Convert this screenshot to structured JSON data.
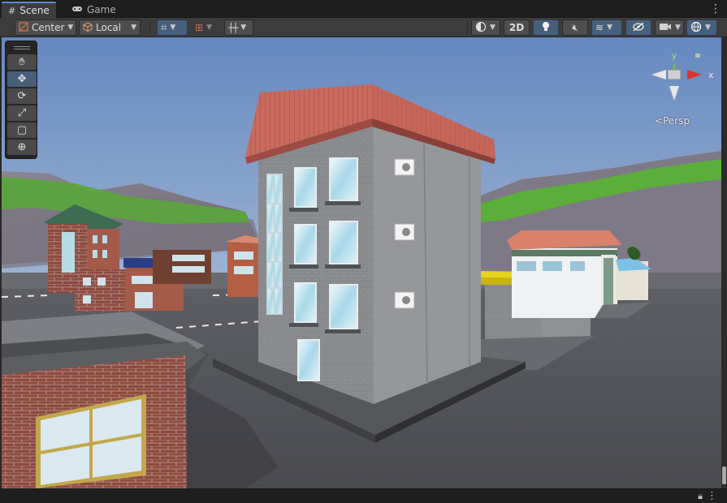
{
  "tabs": [
    {
      "label": "Scene",
      "icon": "grid-icon",
      "active": true
    },
    {
      "label": "Game",
      "icon": "gamepad-icon",
      "active": false
    }
  ],
  "toolbar": {
    "pivot_mode": "Center",
    "pivot_rotation": "Local",
    "mode_2d": "2D"
  },
  "gizmo": {
    "axis_y": "y",
    "axis_x": "x",
    "projection": "Persp"
  },
  "tools": [
    {
      "name": "hand-tool",
      "icon": "hand-icon"
    },
    {
      "name": "move-tool",
      "icon": "move-icon"
    },
    {
      "name": "rotate-tool",
      "icon": "rotate-icon"
    },
    {
      "name": "scale-tool",
      "icon": "scale-icon"
    },
    {
      "name": "rect-tool",
      "icon": "rect-icon"
    },
    {
      "name": "transform-tool",
      "icon": "transform-icon"
    }
  ],
  "colors": {
    "accent": "#46607c",
    "active_tab_border": "#5c8ad6",
    "sky": "#6f8fbd",
    "roof": "#c9665a"
  }
}
